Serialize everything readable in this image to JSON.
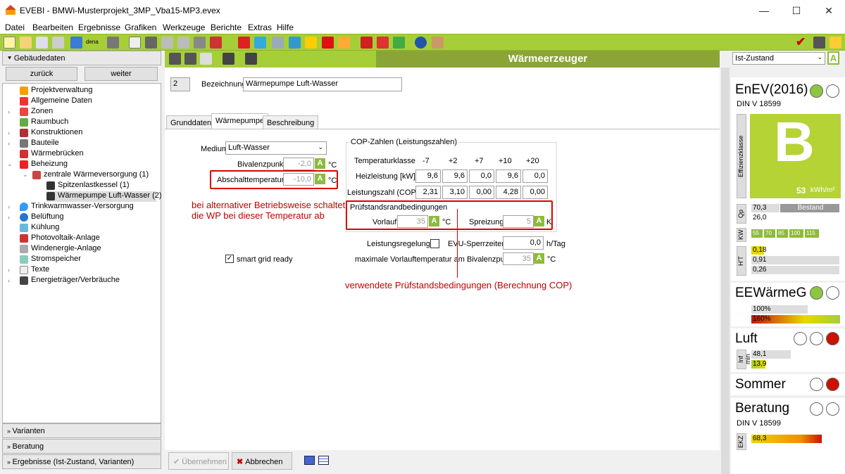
{
  "window": {
    "title": "EVEBI - BMWi-Musterprojekt_3MP_Vba15-MP3.evex",
    "minimize": "—",
    "maximize": "☐",
    "close": "✕"
  },
  "menu": [
    "Datei",
    "Bearbeiten",
    "Ergebnisse",
    "Grafiken",
    "Werkzeuge",
    "Berichte",
    "Extras",
    "Hilfe"
  ],
  "toolbar": {
    "dena_label": "dena",
    "accent": "#a6ce39"
  },
  "left": {
    "section_title": "Gebäudedaten",
    "back": "zurück",
    "forward": "weiter",
    "tree": [
      "Projektverwaltung",
      "Allgemeine Daten",
      "Zonen",
      "Raumbuch",
      "Konstruktionen",
      "Bauteile",
      "Wärmebrücken",
      "Beheizung",
      "zentrale Wärmeversorgung (1)",
      "Spitzenlastkessel (1)",
      "Wärmepumpe Luft-Wasser (2)",
      "Trinkwarmwasser-Versorgung",
      "Belüftung",
      "Kühlung",
      "Photovoltaik-Anlage",
      "Windenergie-Anlage",
      "Stromspeicher",
      "Texte",
      "Energieträger/Verbräuche"
    ],
    "bottom": [
      "Varianten",
      "Beratung",
      "Ergebnisse (Ist-Zustand, Varianten)"
    ]
  },
  "center": {
    "title": "Wärmeerzeuger",
    "number": "2",
    "bez_label": "Bezeichnung",
    "bez_value": "Wärmepumpe Luft-Wasser",
    "tabs": [
      "Grunddaten",
      "Wärmepumpe",
      "Beschreibung"
    ],
    "medium_label": "Medium",
    "medium_value": "Luft-Wasser",
    "biv_label": "Bivalenzpunkt",
    "biv_value": "-2,0",
    "abs_label": "Abschalttemperatur",
    "abs_value": "-10,0",
    "unit_c": "°C",
    "a_btn": "A",
    "cop_title": "COP-Zahlen (Leistungszahlen)",
    "temp_label": "Temperaturklasse",
    "temps": [
      "-7",
      "+2",
      "+7",
      "+10",
      "+20"
    ],
    "heiz_label": "Heizleistung [kW]",
    "heiz": [
      "9,6",
      "9,6",
      "0,0",
      "9,6",
      "0,0"
    ],
    "lz_label": "Leistungszahl (COP)",
    "lz": [
      "2,31",
      "3,10",
      "0,00",
      "4,28",
      "0,00"
    ],
    "pruef_title": "Prüfstandsrandbedingungen",
    "vorlauf_label": "Vorlauf",
    "vorlauf_value": "35",
    "spreiz_label": "Spreizung",
    "spreiz_value": "5",
    "unit_k": "K",
    "lr_label": "Leistungsregelung",
    "evu_label": "EVU-Sperrzeiten",
    "evu_value": "0,0",
    "evu_unit": "h/Tag",
    "maxvl_label": "maximale Vorlauftemperatur am Bivalenzpunkt",
    "maxvl_value": "35",
    "smart_label": "smart grid ready",
    "note1": "bei alternativer Betriebsweise schaltet die WP bei dieser Temperatur ab",
    "note2": "verwendete Prüfstandsbedingungen (Berechnung COP)",
    "ok": "Übernehmen",
    "cancel": "Abbrechen"
  },
  "right": {
    "dropdown": "Ist-Zustand",
    "a": "A",
    "enev": "EnEV(2016)",
    "din1": "DIN V 18599",
    "eff_label": "Effizienzklasse",
    "eff_class": "B",
    "eff_value": "53",
    "eff_unit": "kWh/m²",
    "qp_label": "Qp",
    "qp1": "70,3",
    "bestand": "Bestand",
    "qp2": "26,0",
    "kw_label": "KW",
    "kw": [
      "55",
      "70",
      "85",
      "100",
      "115"
    ],
    "ht_label": "H'T",
    "ht": [
      "0,18",
      "0,91",
      "0,26"
    ],
    "ee": "EEWärmeG",
    "ee1": "100%",
    "ee2": "160%",
    "luft": "Luft",
    "inf_label": "Inf min",
    "luft1": "48,1",
    "luft2": "13,9",
    "sommer": "Sommer",
    "beratung": "Beratung",
    "din2": "DIN V 18599",
    "ekz_label": "EKZ",
    "ekz": "68,3",
    "green": "#a6ce39",
    "red": "#cc1100"
  }
}
